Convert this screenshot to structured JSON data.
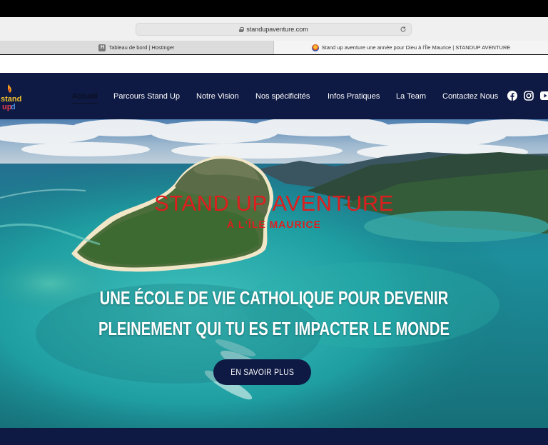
{
  "browser": {
    "url": "standupaventure.com",
    "tabs": [
      {
        "favicon": "hostinger-h-icon",
        "title": "Tableau de bord | Hostinger"
      },
      {
        "favicon": "standup-logo-icon",
        "title": "Stand up aventure une année pour Dieu à l'Île Maurice | STANDUP AVENTURE"
      }
    ]
  },
  "nav": {
    "items": [
      "Accueil",
      "Parcours Stand Up",
      "Notre Vision",
      "Nos spécificités",
      "Infos Pratiques",
      "La Team",
      "Contactez Nous"
    ],
    "logo_text": "stand up",
    "social": [
      "facebook-icon",
      "instagram-icon",
      "youtube-icon"
    ]
  },
  "hero": {
    "title": "STAND UP AVENTURE",
    "subtitle": "À L'ÎLE MAURICE",
    "tagline_line1": "UNE ÉCOLE DE VIE CATHOLIQUE  POUR DEVENIR",
    "tagline_line2": "PLEINEMENT QUI TU ES ET IMPACTER LE MONDE",
    "cta": "EN SAVOIR PLUS"
  },
  "colors": {
    "nav_bg": "#0e1a44",
    "title_red": "#dd1e1e",
    "lagoon": "#1fa5a8"
  }
}
